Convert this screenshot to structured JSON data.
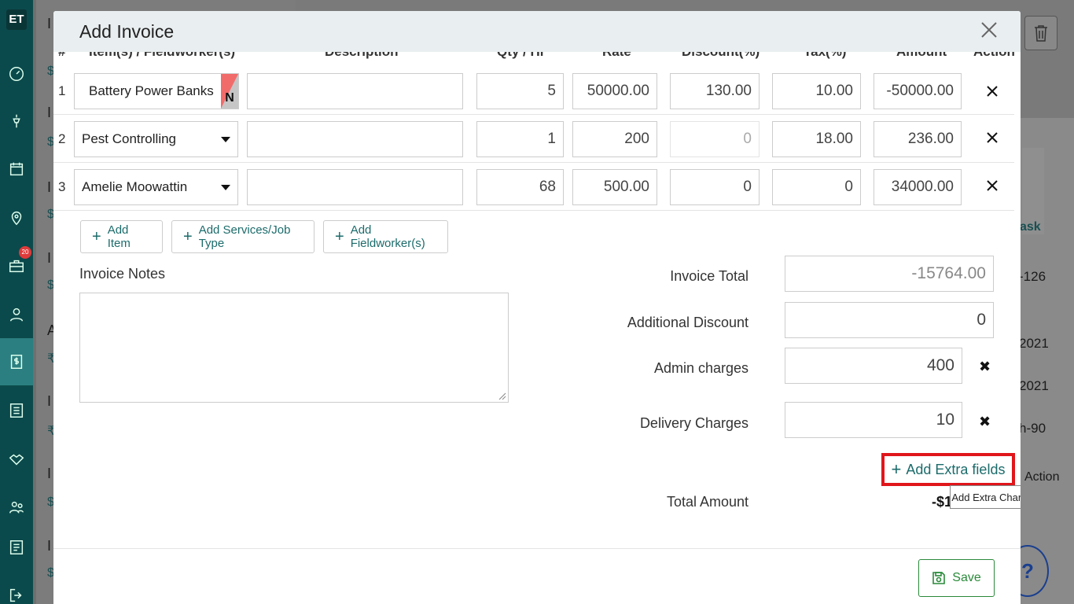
{
  "app": {
    "logo": "ET",
    "sidebar_badge": "20"
  },
  "background": {
    "list_marks": [
      "I",
      "I",
      "I",
      "I",
      "A",
      "I",
      "I",
      "I",
      "I"
    ],
    "list_currency": [
      "$",
      "$",
      "$",
      "$",
      "₹",
      "₹",
      "$",
      "$",
      "$"
    ],
    "right_texts": [
      "-126",
      "2021",
      "2021",
      "h-90",
      "Action",
      "ask"
    ],
    "help": "?"
  },
  "modal": {
    "title": "Add Invoice",
    "columns": [
      "#",
      "Item(s) / Fieldworker(s)",
      "Description",
      "Qty / Hr",
      "Rate",
      "Discount(%)",
      "Tax(%)",
      "Amount",
      "Action"
    ],
    "rows": [
      {
        "num": "1",
        "item": "Battery Power Banks",
        "badge": "N",
        "description": "",
        "qty": "5",
        "rate": "50000.00",
        "discount": "130.00",
        "tax": "10.00",
        "amount": "-50000.00"
      },
      {
        "num": "2",
        "item": "Pest Controlling",
        "description": "",
        "qty": "1",
        "rate": "200",
        "discount": "0",
        "tax": "18.00",
        "amount": "236.00"
      },
      {
        "num": "3",
        "item": "Amelie Moowattin",
        "description": "",
        "qty": "68",
        "rate": "500.00",
        "discount": "0",
        "tax": "0",
        "amount": "34000.00"
      }
    ],
    "buttons": {
      "add_item": "Add Item",
      "add_services": "Add Services/Job Type",
      "add_fieldworker": "Add Fieldworker(s)"
    },
    "notes_label": "Invoice Notes",
    "totals": {
      "invoice_total_label": "Invoice Total",
      "invoice_total": "-15764.00",
      "additional_discount_label": "Additional Discount",
      "additional_discount": "0",
      "admin_charges_label": "Admin charges",
      "admin_charges": "400",
      "delivery_charges_label": "Delivery Charges",
      "delivery_charges": "10",
      "add_extra_fields": "Add Extra fields",
      "tooltip": "Add Extra Charge",
      "total_amount_label": "Total Amount",
      "total_amount": "-$1"
    },
    "save": "Save"
  },
  "colors": {
    "teal": "#0b4a4c",
    "accent_red": "#e0161b",
    "save_green": "#2a8a3a"
  }
}
